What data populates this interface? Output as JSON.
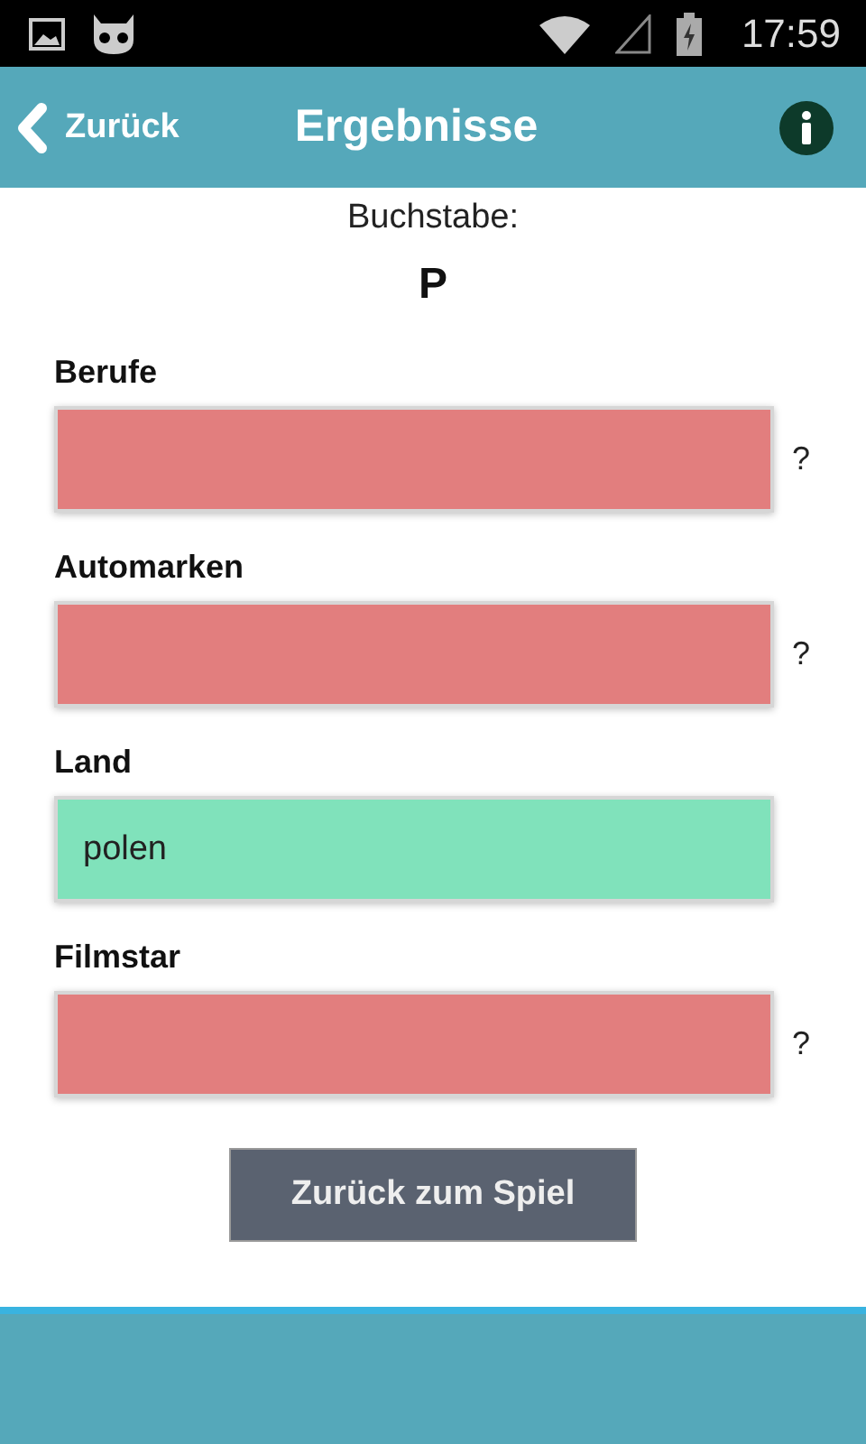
{
  "status_bar": {
    "time": "17:59"
  },
  "header": {
    "back_label": "Zurück",
    "title": "Ergebnisse"
  },
  "letter_label": "Buchstabe:",
  "letter": "P",
  "fields": [
    {
      "label": "Berufe",
      "kind": "wrong",
      "marker": "?"
    },
    {
      "label": "Automarken",
      "kind": "wrong",
      "marker": "?"
    },
    {
      "label": "Land",
      "value": "polen",
      "kind": "right"
    },
    {
      "label": "Filmstar",
      "kind": "wrong",
      "marker": "?"
    }
  ],
  "button": "Zurück zum Spiel"
}
